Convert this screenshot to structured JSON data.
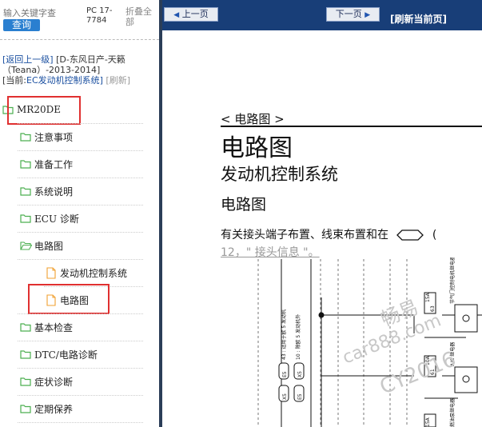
{
  "sidebar": {
    "search_placeholder": "输入关键字查",
    "search_button": "查询",
    "pc_code": "PC 17-7784",
    "collapse_label": "折叠全部",
    "path_back": "[返回上一级]",
    "path_vehicle": "[D-东风日产-天籁（Teana）-2013-2014]",
    "path_current_prefix": "[当前:",
    "path_current": "EC发动机控制系统]",
    "path_refresh": "[刷新]",
    "tree": [
      {
        "label": "MR20DE"
      },
      {
        "label": "注意事项"
      },
      {
        "label": "准备工作"
      },
      {
        "label": "系统说明"
      },
      {
        "label": "ECU 诊断"
      },
      {
        "label": "电路图"
      },
      {
        "label": "发动机控制系统"
      },
      {
        "label": "电路图"
      },
      {
        "label": "基本检查"
      },
      {
        "label": "DTC/电路诊断"
      },
      {
        "label": "症状诊断"
      },
      {
        "label": "定期保养"
      }
    ]
  },
  "toolbar": {
    "prev_label": "上一页",
    "next_label": "下一页",
    "refresh_label": "[刷新当前页]"
  },
  "doc": {
    "section": "< 电路图 >",
    "title": "电路图",
    "subtitle": "发动机控制系统",
    "heading": "电路图",
    "paragraph": "有关接头端子布置、线束布置和在",
    "link": "12，\" 接头信息 \"。",
    "diagram_labels": {
      "label1": "43 : 适用于欧 5 发动机",
      "label2": "10 : 除欧 5 发动机外",
      "e5": "E5",
      "x5": "X5",
      "fuse1_amp": "15A",
      "fuse1_id": "63",
      "fuse2_amp": "10A",
      "fuse2_id": "61",
      "fuse3_amp": "15A",
      "relay1": "节气门控制电机继电器",
      "relay2": "A/C 继电器",
      "relay3": "燃油泵继电器"
    },
    "watermark": [
      "畅易",
      "car888.com",
      "CY2016"
    ]
  },
  "colors": {
    "topbar": "#183e78",
    "highlight": "#e03030",
    "folder": "#4caf50",
    "search_button": "#2a7fd0"
  }
}
